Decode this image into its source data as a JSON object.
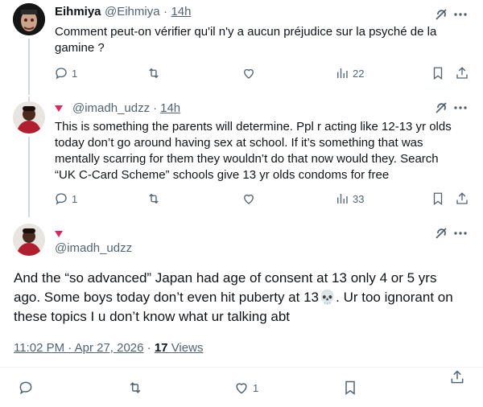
{
  "tweet1": {
    "display_name": "Eihmiya",
    "handle": "@Eihmiya",
    "separator": "·",
    "time": "14h",
    "text_line1": "Comment peut-on vérifier qu'il n'y a aucun préjudice sur la psyché de la",
    "text_line2": "gamine ?",
    "replies": "1",
    "views": "22"
  },
  "tweet2": {
    "handle": "@imadh_udzz",
    "separator": "·",
    "time": "14h",
    "text_lines": [
      "This is something the parents will determine. Ppl r acting like 12-13 yr olds",
      "today don’t go around having sex at school. If it’s something that was",
      "mentally scarring for them they wouldn’t do that now would they. Search",
      "“UK C-Card Scheme” schools give 13 yr olds condoms for free"
    ],
    "replies": "1",
    "views": "33"
  },
  "main": {
    "handle": "@imadh_udzz",
    "text_lines": [
      "And the “so advanced” Japan had age of consent at 13 only 4 or 5 yrs",
      "ago. Some boys today don’t even hit puberty at 13💀. Ur too ignorant on",
      "these topics I u don’t know what ur talking abt"
    ],
    "timestamp": "11:02 PM · Apr 27, 2026",
    "meta_sep": "·",
    "views_count": "17",
    "views_label": "Views",
    "likes": "1"
  },
  "icons": {
    "reply": "reply-icon",
    "retweet": "retweet-icon",
    "like": "heart-icon",
    "views": "views-chart-icon",
    "bookmark": "bookmark-icon",
    "share": "share-icon",
    "grok": "grok-icon",
    "more": "more-icon"
  },
  "colors": {
    "text": "#0f1419",
    "muted": "#536471",
    "divider": "#eff3f4",
    "badge": "#e0245e"
  }
}
